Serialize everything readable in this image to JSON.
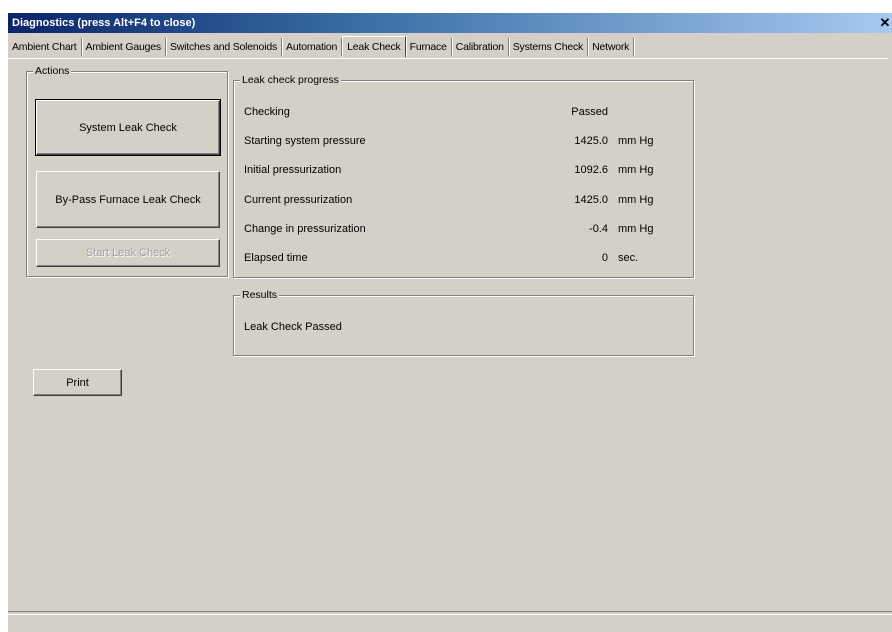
{
  "window": {
    "title": "Diagnostics  (press Alt+F4 to close)",
    "close_glyph": "✕"
  },
  "tabs": [
    {
      "label": "Ambient Chart"
    },
    {
      "label": "Ambient Gauges"
    },
    {
      "label": "Switches and Solenoids"
    },
    {
      "label": "Automation"
    },
    {
      "label": "Leak Check",
      "active": true
    },
    {
      "label": "Furnace"
    },
    {
      "label": "Calibration"
    },
    {
      "label": "Systems Check"
    },
    {
      "label": "Network"
    }
  ],
  "actions": {
    "legend": "Actions",
    "system_leak_check": "System Leak Check",
    "bypass_furnace_leak_check": "By-Pass Furnace Leak Check",
    "start_leak_check": "Start Leak Check"
  },
  "progress": {
    "legend": "Leak check progress",
    "rows": [
      {
        "label": "Checking",
        "value": "Passed",
        "unit": ""
      },
      {
        "label": "Starting system pressure",
        "value": "1425.0",
        "unit": "mm Hg"
      },
      {
        "label": "Initial pressurization",
        "value": "1092.6",
        "unit": "mm Hg"
      },
      {
        "label": "Current pressurization",
        "value": "1425.0",
        "unit": "mm Hg"
      },
      {
        "label": "Change in pressurization",
        "value": "-0.4",
        "unit": "mm Hg"
      },
      {
        "label": "Elapsed time",
        "value": "0",
        "unit": "sec."
      }
    ]
  },
  "results": {
    "legend": "Results",
    "text": "Leak Check Passed"
  },
  "print_button": "Print"
}
